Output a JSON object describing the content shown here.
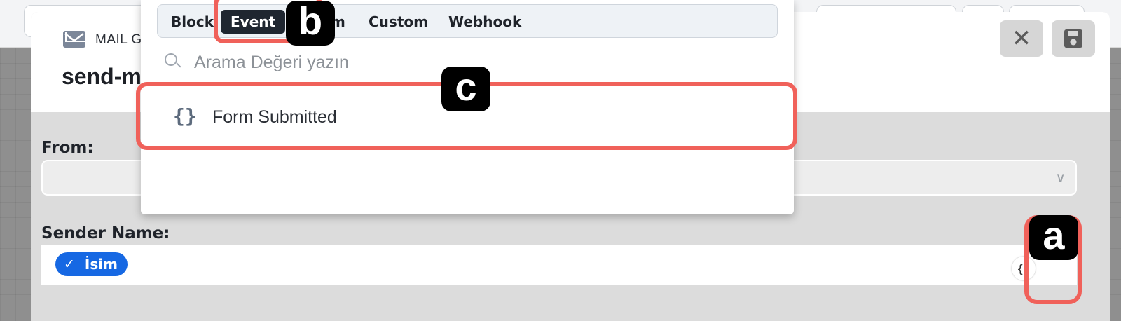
{
  "modal": {
    "group_label": "MAIL G",
    "step_title": "send-m",
    "close_symbol": "✕",
    "save_icon": "save-icon"
  },
  "form": {
    "from_label": "From:",
    "from_value": "",
    "sender_label": "Sender Name:",
    "sender_chip": "İsim",
    "variable_button_symbol": "{}"
  },
  "popover": {
    "tabs": [
      "Block",
      "Event",
      "m",
      "Custom",
      "Webhook"
    ],
    "active_tab": "Event",
    "search_placeholder": "Arama Değeri yazın",
    "items": [
      {
        "label": "Form Submitted",
        "icon": "curly-braces-icon"
      }
    ]
  },
  "annotations": [
    "b",
    "c",
    "a"
  ],
  "colors": {
    "highlight": "#f0615a",
    "chip": "#1668e3",
    "active_tab": "#1f2630"
  }
}
